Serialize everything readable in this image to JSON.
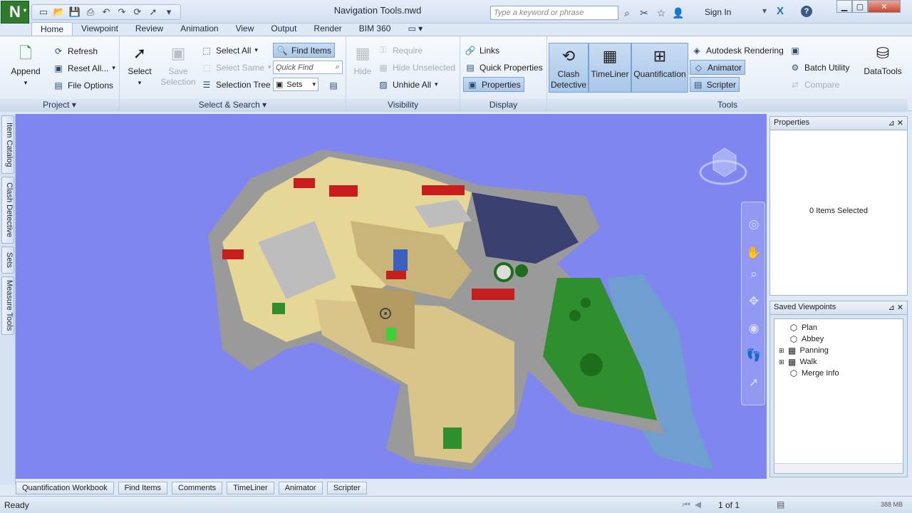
{
  "window": {
    "title": "Navigation Tools.nwd",
    "search_placeholder": "Type a keyword or phrase",
    "sign_in": "Sign In"
  },
  "tabs": [
    "Home",
    "Viewpoint",
    "Review",
    "Animation",
    "View",
    "Output",
    "Render",
    "BIM 360"
  ],
  "ribbon": {
    "project": {
      "label": "Project",
      "append": "Append",
      "refresh": "Refresh",
      "reset_all": "Reset All...",
      "file_options": "File Options"
    },
    "select_search": {
      "label": "Select & Search",
      "select": "Select",
      "save_selection_1": "Save",
      "save_selection_2": "Selection",
      "select_all": "Select All",
      "select_same": "Select Same",
      "selection_tree": "Selection Tree",
      "find_items": "Find Items",
      "quick_find_placeholder": "Quick Find",
      "sets": "Sets"
    },
    "visibility": {
      "label": "Visibility",
      "hide": "Hide",
      "require": "Require",
      "hide_unselected": "Hide Unselected",
      "unhide_all": "Unhide All"
    },
    "display": {
      "label": "Display",
      "links": "Links",
      "quick_properties": "Quick Properties",
      "properties": "Properties"
    },
    "tools": {
      "label": "Tools",
      "clash_1": "Clash",
      "clash_2": "Detective",
      "timeliner": "TimeLiner",
      "quantification": "Quantification",
      "autodesk_rendering": "Autodesk Rendering",
      "animator": "Animator",
      "scripter": "Scripter",
      "batch_utility": "Batch Utility",
      "compare": "Compare",
      "datatools": "DataTools"
    }
  },
  "side_tabs": [
    "Item Catalog",
    "Clash Detective",
    "Sets",
    "Measure Tools"
  ],
  "properties_panel": {
    "title": "Properties",
    "status": "0 Items Selected"
  },
  "saved_viewpoints": {
    "title": "Saved Viewpoints",
    "items": [
      "Plan",
      "Abbey",
      "Panning",
      "Walk",
      "Merge Info"
    ]
  },
  "bottom_tabs": [
    "Quantification Workbook",
    "Find Items",
    "Comments",
    "TimeLiner",
    "Animator",
    "Scripter"
  ],
  "status": {
    "text": "Ready",
    "page": "1 of 1",
    "memory": "388 MB"
  },
  "colors": {
    "viewport_bg": "#7f86ef",
    "grass": "#2f8f2f",
    "water": "#6f9fd0"
  }
}
